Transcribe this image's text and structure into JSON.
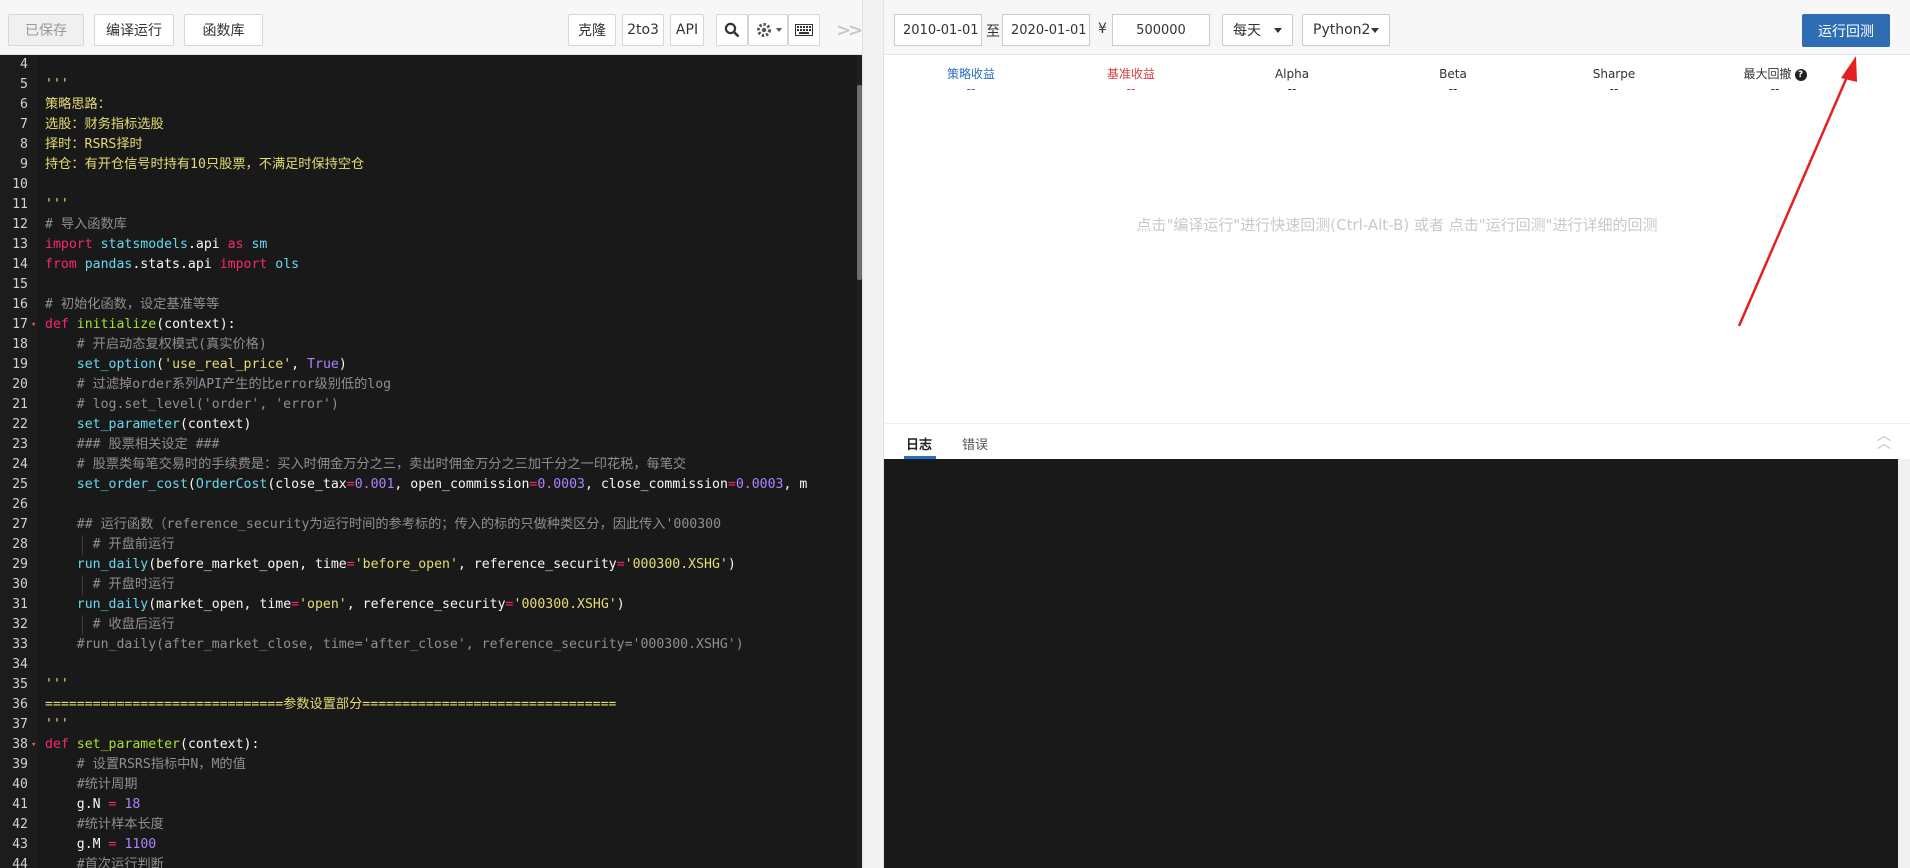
{
  "left_toolbar": {
    "saved": "已保存",
    "compile_run": "编译运行",
    "library": "函数库",
    "clone": "克隆",
    "to3": "2to3",
    "api": "API"
  },
  "right_toolbar": {
    "start_date": "2010-01-01",
    "to_label": "至",
    "end_date": "2020-01-01",
    "currency": "¥",
    "capital": "500000",
    "frequency": "每天",
    "python_version": "Python2",
    "run_backtest": "运行回测"
  },
  "metrics": [
    {
      "label": "策略收益",
      "value": "--",
      "color": "#2a6ebd"
    },
    {
      "label": "基准收益",
      "value": "--",
      "color": "#d43f3a"
    },
    {
      "label": "Alpha",
      "value": "--",
      "color": "#333333"
    },
    {
      "label": "Beta",
      "value": "--",
      "color": "#333333"
    },
    {
      "label": "Sharpe",
      "value": "--",
      "color": "#333333"
    },
    {
      "label": "最大回撤",
      "value": "--",
      "color": "#333333"
    }
  ],
  "hint": "点击\"编译运行\"进行快速回测(Ctrl-Alt-B) 或者 点击\"运行回测\"进行详细的回测",
  "log_tabs": {
    "log": "日志",
    "error": "错误"
  },
  "editor_lines": [
    {
      "n": "4",
      "code": ""
    },
    {
      "n": "5",
      "code": "'''"
    },
    {
      "n": "6",
      "code": "策略思路："
    },
    {
      "n": "7",
      "code": "选股：财务指标选股"
    },
    {
      "n": "8",
      "code": "择时：RSRS择时"
    },
    {
      "n": "9",
      "code": "持仓：有开仓信号时持有10只股票，不满足时保持空仓"
    },
    {
      "n": "10",
      "code": ""
    },
    {
      "n": "11",
      "code": "'''"
    },
    {
      "n": "12",
      "code": "# 导入函数库"
    },
    {
      "n": "13",
      "code": "import statsmodels.api as sm"
    },
    {
      "n": "14",
      "code": "from pandas.stats.api import ols"
    },
    {
      "n": "15",
      "code": ""
    },
    {
      "n": "16",
      "code": "# 初始化函数，设定基准等等"
    },
    {
      "n": "17",
      "code": "def initialize(context):"
    },
    {
      "n": "18",
      "code": "    # 开启动态复权模式(真实价格)"
    },
    {
      "n": "19",
      "code": "    set_option('use_real_price', True)"
    },
    {
      "n": "20",
      "code": "    # 过滤掉order系列API产生的比error级别低的log"
    },
    {
      "n": "21",
      "code": "    # log.set_level('order', 'error')"
    },
    {
      "n": "22",
      "code": "    set_parameter(context)"
    },
    {
      "n": "23",
      "code": "    ### 股票相关设定 ###"
    },
    {
      "n": "24",
      "code": "    # 股票类每笔交易时的手续费是：买入时佣金万分之三，卖出时佣金万分之三加千分之一印花税，每笔交"
    },
    {
      "n": "25",
      "code": "    set_order_cost(OrderCost(close_tax=0.001, open_commission=0.0003, close_commission=0.0003, m"
    },
    {
      "n": "26",
      "code": ""
    },
    {
      "n": "27",
      "code": "    ## 运行函数（reference_security为运行时间的参考标的；传入的标的只做种类区分，因此传入'000300"
    },
    {
      "n": "28",
      "code": "      # 开盘前运行"
    },
    {
      "n": "29",
      "code": "    run_daily(before_market_open, time='before_open', reference_security='000300.XSHG')"
    },
    {
      "n": "30",
      "code": "      # 开盘时运行"
    },
    {
      "n": "31",
      "code": "    run_daily(market_open, time='open', reference_security='000300.XSHG')"
    },
    {
      "n": "32",
      "code": "      # 收盘后运行"
    },
    {
      "n": "33",
      "code": "    #run_daily(after_market_close, time='after_close', reference_security='000300.XSHG')"
    },
    {
      "n": "34",
      "code": ""
    },
    {
      "n": "35",
      "code": "'''"
    },
    {
      "n": "36",
      "code": "==============================参数设置部分================================"
    },
    {
      "n": "37",
      "code": "'''"
    },
    {
      "n": "38",
      "code": "def set_parameter(context):"
    },
    {
      "n": "39",
      "code": "    # 设置RSRS指标中N，M的值"
    },
    {
      "n": "40",
      "code": "    #统计周期"
    },
    {
      "n": "41",
      "code": "    g.N = 18"
    },
    {
      "n": "42",
      "code": "    #统计样本长度"
    },
    {
      "n": "43",
      "code": "    g.M = 1100"
    },
    {
      "n": "44",
      "code": "    #首次运行判断"
    }
  ]
}
